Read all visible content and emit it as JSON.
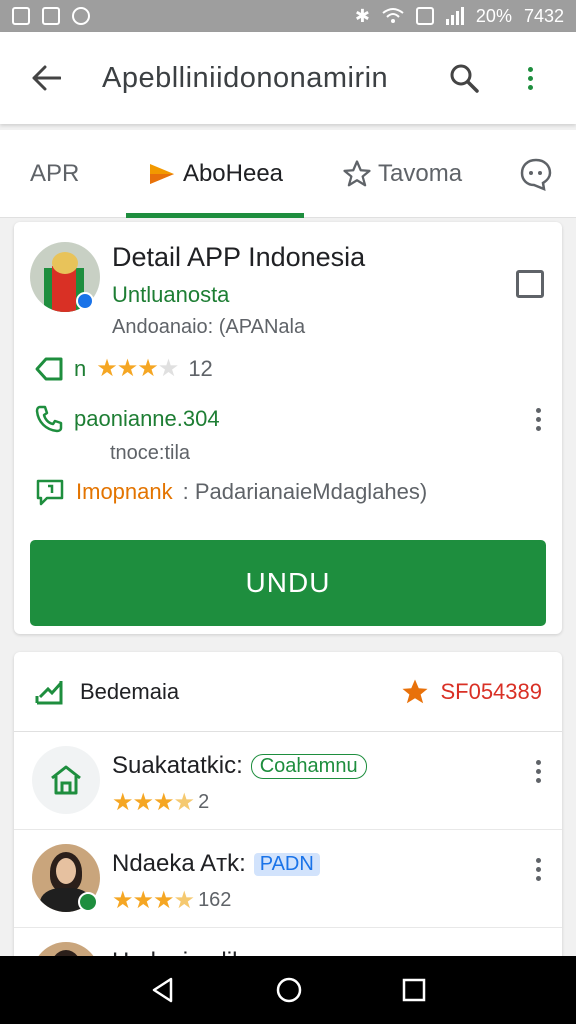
{
  "status_bar": {
    "battery": "20%",
    "time": "7432"
  },
  "app_bar": {
    "title": "Apeblliniidononamirin"
  },
  "tabs": [
    {
      "label": "APR",
      "active": false
    },
    {
      "label": "AboHeea",
      "active": true
    },
    {
      "label": "Tavoma",
      "active": false
    }
  ],
  "app": {
    "title": "Detail APP Indonesia",
    "developer": "Untluanosta",
    "meta": "Andoanaio: (APANala",
    "rating_prefix": "n",
    "rating_value": 3.5,
    "rating_count": "12",
    "contact": "paonianne.304",
    "contact_sub": "tnoce:tila",
    "important_label": "Imopnank",
    "important_value": ": PadarianaieMdaglahes)",
    "download_label": "UNDU"
  },
  "reviews": {
    "header_label": "Bedemaia",
    "header_score": "SF054389",
    "items": [
      {
        "name": "Suakatatkic:",
        "tag": "Coahamnu",
        "tag_style": "outline",
        "rating": 3.5,
        "count": "2"
      },
      {
        "name": "Ndaeka Aтk:",
        "tag": "PADN",
        "tag_style": "blue",
        "rating": 3.5,
        "count": "162"
      },
      {
        "name": "Hnduaina lila",
        "tag": "",
        "tag_style": "",
        "rating": 0,
        "count": ""
      }
    ]
  },
  "colors": {
    "primary": "#1e8e3e",
    "star": "#f5a623",
    "accent_red": "#d93025"
  }
}
